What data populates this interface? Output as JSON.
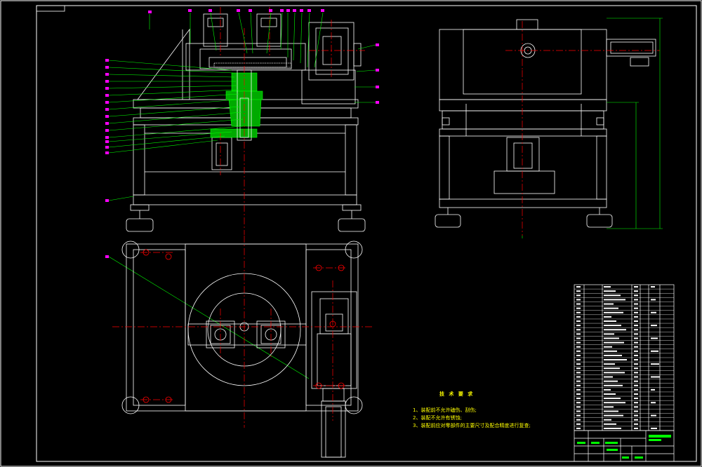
{
  "drawing": {
    "colors": {
      "background": "#000000",
      "outline": "#ffffff",
      "centerline": "#ff0000",
      "leader": "#00ff00",
      "balloon": "#ff00ff",
      "section": "#00cc00",
      "dimension": "#00ffff",
      "note": "#ffff00"
    }
  },
  "tech_requirements": {
    "title": "技 术 要 求",
    "items": [
      "1、装配前不允许磕伤、刮伤;",
      "2、装配不允许有锈蚀;",
      "3、装配前应对零部件的主要尺寸及配合精度进行复查;"
    ]
  }
}
